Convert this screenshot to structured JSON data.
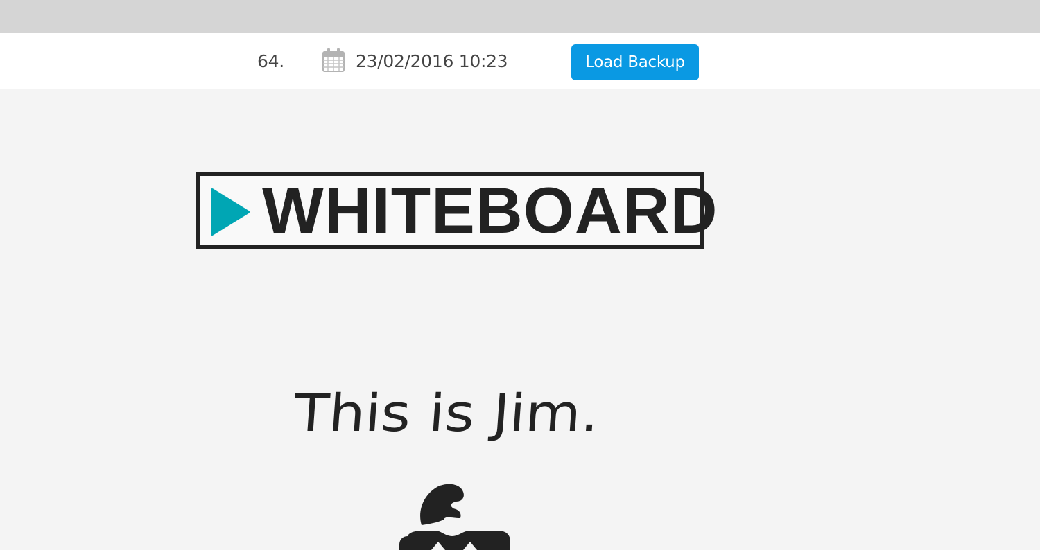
{
  "backup": {
    "index": "64.",
    "date": "23/02/2016 10:23",
    "load_label": "Load Backup",
    "accent_color": "#0a99e3"
  },
  "whiteboard": {
    "logo_text": "WHITEBOARD",
    "logo_accent_color": "#00a6b4",
    "caption": "This is Jim."
  },
  "icons": {
    "date_icon": "calendar-icon",
    "logo_icon": "play-triangle-icon"
  }
}
